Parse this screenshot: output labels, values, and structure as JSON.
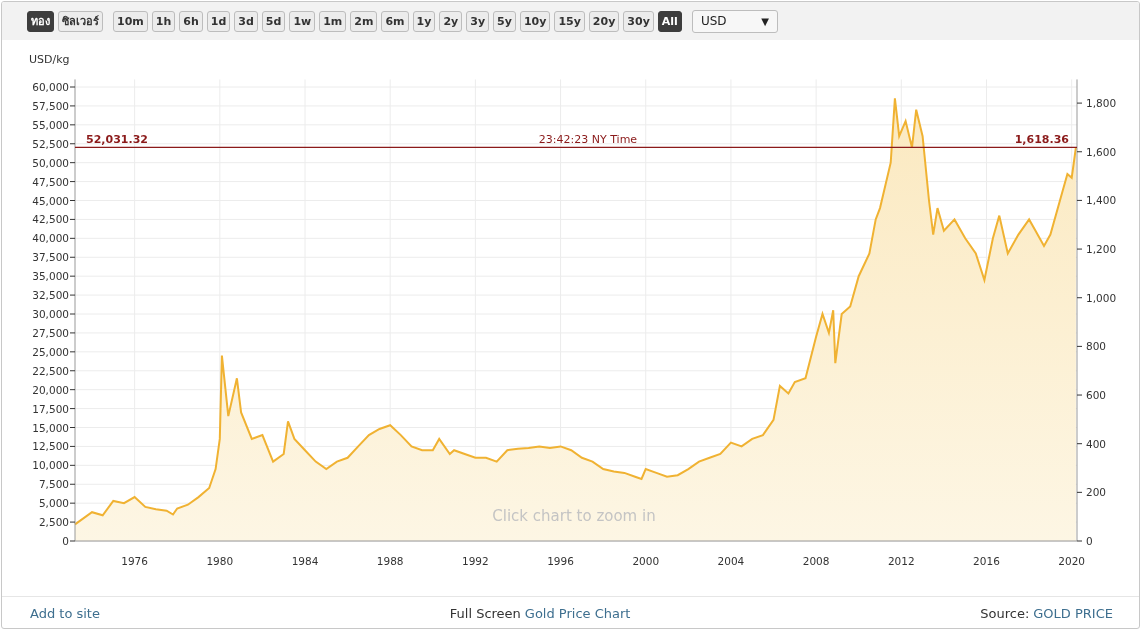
{
  "toolbar": {
    "metals": [
      {
        "label": "ทอง",
        "selected": true
      },
      {
        "label": "ซิลเวอร์",
        "selected": false
      }
    ],
    "ranges": [
      {
        "label": "10m",
        "selected": false
      },
      {
        "label": "1h",
        "selected": false
      },
      {
        "label": "6h",
        "selected": false
      },
      {
        "label": "1d",
        "selected": false
      },
      {
        "label": "3d",
        "selected": false
      },
      {
        "label": "5d",
        "selected": false
      },
      {
        "label": "1w",
        "selected": false
      },
      {
        "label": "1m",
        "selected": false
      },
      {
        "label": "2m",
        "selected": false
      },
      {
        "label": "6m",
        "selected": false
      },
      {
        "label": "1y",
        "selected": false
      },
      {
        "label": "2y",
        "selected": false
      },
      {
        "label": "3y",
        "selected": false
      },
      {
        "label": "5y",
        "selected": false
      },
      {
        "label": "10y",
        "selected": false
      },
      {
        "label": "15y",
        "selected": false
      },
      {
        "label": "20y",
        "selected": false
      },
      {
        "label": "30y",
        "selected": false
      },
      {
        "label": "All",
        "selected": true
      }
    ],
    "currency": {
      "value": "USD",
      "caret": "▼"
    }
  },
  "chart": {
    "current_price": {
      "left_label": "52,031.32",
      "center_label": "23:42:23 NY Time",
      "right_label": "1,618.36"
    },
    "hint": "Click chart to zoom in",
    "right_axis": {
      "ticks": [
        "1,800",
        "1,600",
        "1,400",
        "1,200",
        "1,000",
        "800",
        "600",
        "400",
        "200",
        "0"
      ]
    },
    "chart_data": {
      "type": "area",
      "ylabel": "USD/kg",
      "xlim": [
        1973.2,
        2020.25
      ],
      "ylim": [
        0,
        61000
      ],
      "grid": true,
      "ref_lines": [
        {
          "axis": "y",
          "value": 52031.32,
          "color": "#8b1a1a"
        }
      ],
      "xticks": [
        1976,
        1980,
        1984,
        1988,
        1992,
        1996,
        2000,
        2004,
        2008,
        2012,
        2016,
        2020
      ],
      "yticks": [
        {
          "value": 0,
          "label": "0"
        },
        {
          "value": 2500,
          "label": "2,500"
        },
        {
          "value": 5000,
          "label": "5,000"
        },
        {
          "value": 7500,
          "label": "7,500"
        },
        {
          "value": 10000,
          "label": "10,000"
        },
        {
          "value": 12500,
          "label": "12,500"
        },
        {
          "value": 15000,
          "label": "15,000"
        },
        {
          "value": 17500,
          "label": "17,500"
        },
        {
          "value": 20000,
          "label": "20,000"
        },
        {
          "value": 22500,
          "label": "22,500"
        },
        {
          "value": 25000,
          "label": "25,000"
        },
        {
          "value": 27500,
          "label": "27,500"
        },
        {
          "value": 30000,
          "label": "30,000"
        },
        {
          "value": 32500,
          "label": "32,500"
        },
        {
          "value": 35000,
          "label": "35,000"
        },
        {
          "value": 37500,
          "label": "37,500"
        },
        {
          "value": 40000,
          "label": "40,000"
        },
        {
          "value": 42500,
          "label": "42,500"
        },
        {
          "value": 45000,
          "label": "45,000"
        },
        {
          "value": 47500,
          "label": "47,500"
        },
        {
          "value": 50000,
          "label": "50,000"
        },
        {
          "value": 52500,
          "label": "52,500"
        },
        {
          "value": 55000,
          "label": "55,000"
        },
        {
          "value": 57500,
          "label": "57,500"
        },
        {
          "value": 60000,
          "label": "60,000"
        }
      ],
      "x": [
        1973.2,
        1974,
        1974.5,
        1975,
        1975.5,
        1976,
        1976.5,
        1977,
        1977.5,
        1977.8,
        1978,
        1978.5,
        1979,
        1979.5,
        1979.8,
        1980,
        1980.1,
        1980.4,
        1980.8,
        1981,
        1981.5,
        1982,
        1982.5,
        1983,
        1983.2,
        1983.5,
        1984,
        1984.5,
        1985,
        1985.5,
        1986,
        1986.5,
        1987,
        1987.5,
        1988,
        1988.5,
        1989,
        1989.5,
        1990,
        1990.3,
        1990.8,
        1991,
        1991.5,
        1992,
        1992.5,
        1993,
        1993.5,
        1994,
        1994.5,
        1995,
        1995.5,
        1996,
        1996.5,
        1997,
        1997.5,
        1998,
        1998.5,
        1999,
        1999.5,
        1999.8,
        2000,
        2000.5,
        2001,
        2001.5,
        2002,
        2002.5,
        2003,
        2003.5,
        2004,
        2004.5,
        2005,
        2005.5,
        2006,
        2006.3,
        2006.7,
        2007,
        2007.5,
        2008,
        2008.3,
        2008.6,
        2008.8,
        2008.9,
        2009.2,
        2009.6,
        2010,
        2010.5,
        2010.8,
        2011,
        2011.5,
        2011.7,
        2011.9,
        2012.2,
        2012.5,
        2012.7,
        2013,
        2013.3,
        2013.5,
        2013.7,
        2014,
        2014.5,
        2015,
        2015.5,
        2015.9,
        2016.3,
        2016.6,
        2017,
        2017.5,
        2018,
        2018.3,
        2018.7,
        2019,
        2019.5,
        2019.8,
        2020,
        2020.2
      ],
      "series": [
        {
          "color": "#f0b232",
          "values": [
            2200,
            3800,
            3400,
            5300,
            5000,
            5800,
            4500,
            4200,
            4000,
            3500,
            4300,
            4800,
            5800,
            7000,
            9500,
            13500,
            24500,
            16500,
            21500,
            17000,
            13500,
            14000,
            10500,
            11500,
            15800,
            13500,
            12000,
            10500,
            9500,
            10500,
            11000,
            12500,
            14000,
            14800,
            15300,
            14000,
            12500,
            12000,
            12000,
            13500,
            11500,
            12000,
            11500,
            11000,
            11000,
            10500,
            12000,
            12200,
            12300,
            12500,
            12300,
            12500,
            12000,
            11000,
            10500,
            9500,
            9200,
            9000,
            8500,
            8200,
            9500,
            9000,
            8500,
            8700,
            9500,
            10500,
            11000,
            11500,
            13000,
            12500,
            13500,
            14000,
            16000,
            20500,
            19500,
            21000,
            21500,
            27000,
            30000,
            27500,
            30500,
            23500,
            30000,
            31000,
            35000,
            38000,
            42500,
            44000,
            50000,
            58500,
            53500,
            55500,
            52000,
            57000,
            53500,
            45000,
            40500,
            44000,
            41000,
            42500,
            40000,
            38000,
            34500,
            40000,
            43000,
            38000,
            40500,
            42500,
            41000,
            39000,
            40500,
            45500,
            48500,
            48000,
            52000
          ]
        }
      ]
    }
  },
  "footer": {
    "add_link": "Add to site",
    "fullscreen_text": "Full Screen",
    "chart_link": "Gold Price Chart",
    "source_text": "Source:",
    "source_link": "GOLD PRICE"
  }
}
